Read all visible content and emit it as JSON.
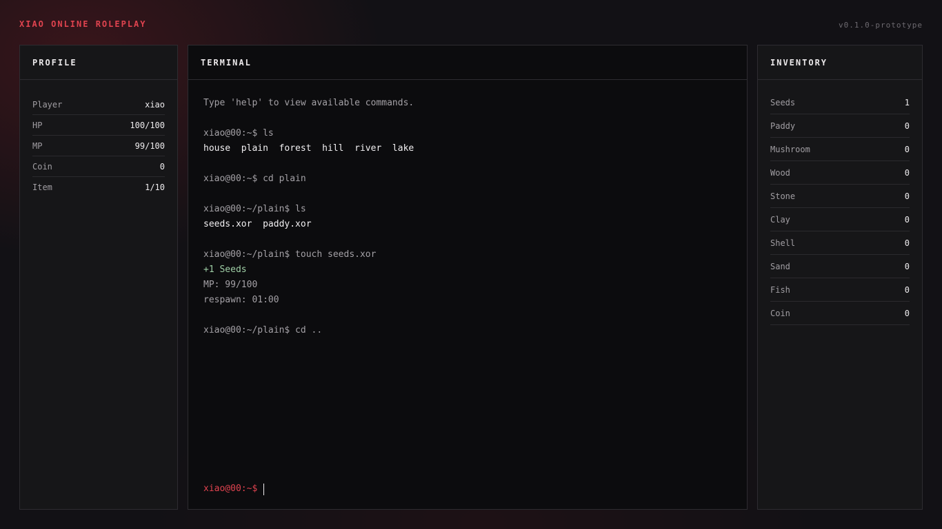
{
  "app": {
    "title": "XIAO ONLINE ROLEPLAY",
    "version": "v0.1.0-prototype"
  },
  "profile": {
    "title": "PROFILE",
    "rows": [
      {
        "label": "Player",
        "value": "xiao"
      },
      {
        "label": "HP",
        "value": "100/100"
      },
      {
        "label": "MP",
        "value": "99/100"
      },
      {
        "label": "Coin",
        "value": "0"
      },
      {
        "label": "Item",
        "value": "1/10"
      }
    ]
  },
  "terminal": {
    "title": "TERMINAL",
    "lines": [
      {
        "text": "Type 'help' to view available commands.",
        "style": "dim"
      },
      {
        "text": "",
        "style": "gap"
      },
      {
        "text": "xiao@00:~$ ls",
        "style": "dim"
      },
      {
        "text": "house  plain  forest  hill  river  lake",
        "style": "bright"
      },
      {
        "text": "",
        "style": "gap"
      },
      {
        "text": "xiao@00:~$ cd plain",
        "style": "dim"
      },
      {
        "text": "",
        "style": "gap"
      },
      {
        "text": "xiao@00:~/plain$ ls",
        "style": "dim"
      },
      {
        "text": "seeds.xor  paddy.xor",
        "style": "bright"
      },
      {
        "text": "",
        "style": "gap"
      },
      {
        "text": "xiao@00:~/plain$ touch seeds.xor",
        "style": "dim"
      },
      {
        "text": "+1 Seeds",
        "style": "green"
      },
      {
        "text": "MP: 99/100",
        "style": "dim"
      },
      {
        "text": "respawn: 01:00",
        "style": "dim"
      },
      {
        "text": "",
        "style": "gap"
      },
      {
        "text": "xiao@00:~/plain$ cd ..",
        "style": "dim"
      }
    ],
    "prompt": "xiao@00:~$",
    "input_value": ""
  },
  "inventory": {
    "title": "INVENTORY",
    "items": [
      {
        "label": "Seeds",
        "value": "1"
      },
      {
        "label": "Paddy",
        "value": "0"
      },
      {
        "label": "Mushroom",
        "value": "0"
      },
      {
        "label": "Wood",
        "value": "0"
      },
      {
        "label": "Stone",
        "value": "0"
      },
      {
        "label": "Clay",
        "value": "0"
      },
      {
        "label": "Shell",
        "value": "0"
      },
      {
        "label": "Sand",
        "value": "0"
      },
      {
        "label": "Fish",
        "value": "0"
      },
      {
        "label": "Coin",
        "value": "0"
      }
    ]
  },
  "colors": {
    "accent": "#e0434f",
    "success": "#9fcfa6",
    "background": "#121115"
  }
}
